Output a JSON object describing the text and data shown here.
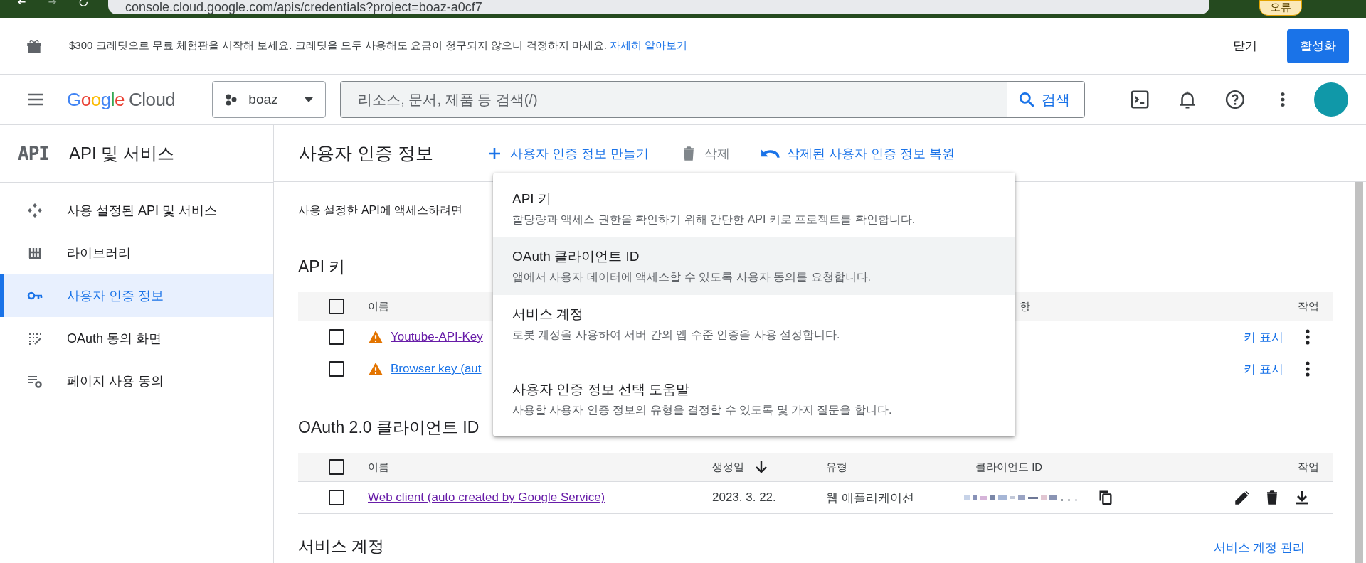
{
  "browser": {
    "url": "console.cloud.google.com/apis/credentials?project=boaz-a0cf7",
    "badge": "오류"
  },
  "promo_banner": {
    "text": "$300 크레딧으로 무료 체험판을 시작해 보세요. 크레딧을 모두 사용해도 요금이 청구되지 않으니 걱정하지 마세요.",
    "link": "자세히 알아보기",
    "dismiss": "닫기",
    "activate": "활성화"
  },
  "header": {
    "logo": "Google",
    "product": "Cloud",
    "project": "boaz",
    "search_placeholder": "리소스, 문서, 제품 등 검색(/)",
    "search_button": "검색"
  },
  "sidebar": {
    "badge": "API",
    "title": "API 및 서비스",
    "items": [
      {
        "label": "사용 설정된 API 및 서비스",
        "kind": "diamond",
        "selected": false
      },
      {
        "label": "라이브러리",
        "kind": "library",
        "selected": false
      },
      {
        "label": "사용자 인증 정보",
        "kind": "key",
        "selected": true
      },
      {
        "label": "OAuth 동의 화면",
        "kind": "consent",
        "selected": false
      },
      {
        "label": "페이지 사용 동의",
        "kind": "settings",
        "selected": false
      }
    ]
  },
  "main": {
    "title": "사용자 인증 정보",
    "actions": [
      {
        "label": "사용자 인증 정보 만들기",
        "kind": "add",
        "disabled": false
      },
      {
        "label": "삭제",
        "kind": "delete",
        "disabled": true
      },
      {
        "label": "삭제된 사용자 인증 정보 복원",
        "kind": "restore",
        "disabled": false
      }
    ],
    "intro": "사용 설정한 API에 액세스하려면",
    "api_keys": {
      "heading": "API 키",
      "all_checked": false,
      "columns": [
        "이름",
        "항",
        "작업"
      ],
      "rows": [
        {
          "name": "Youtube-API-Key",
          "visited": true,
          "warning": true,
          "checked": false,
          "action": "키 표시"
        },
        {
          "name": "Browser key (aut",
          "visited": false,
          "warning": true,
          "checked": false,
          "action": "키 표시"
        }
      ]
    },
    "oauth_clients": {
      "heading": "OAuth 2.0 클라이언트 ID",
      "all_checked": false,
      "columns": [
        "이름",
        "생성일",
        "유형",
        "클라이언트 ID",
        "작업"
      ],
      "rows": [
        {
          "name": "Web client (auto created by Google Service)",
          "visited": true,
          "checked": false,
          "created": "2023. 3. 22.",
          "type": "웹 애플리케이션"
        }
      ]
    },
    "service_accounts": {
      "heading": "서비스 계정",
      "link": "서비스 계정 관리"
    }
  },
  "create_menu": {
    "items": [
      {
        "title": "API 키",
        "description": "할당량과 액세스 권한을 확인하기 위해 간단한 API 키로 프로젝트를 확인합니다.",
        "highlighted": false,
        "divider_before": false
      },
      {
        "title": "OAuth 클라이언트 ID",
        "description": "앱에서 사용자 데이터에 액세스할 수 있도록 사용자 동의를 요청합니다.",
        "highlighted": true,
        "divider_before": false
      },
      {
        "title": "서비스 계정",
        "description": "로봇 계정을 사용하여 서버 간의 앱 수준 인증을 사용 설정합니다.",
        "highlighted": false,
        "divider_before": false
      },
      {
        "title": "사용자 인증 정보 선택 도움말",
        "description": "사용할 사용자 인증 정보의 유형을 결정할 수 있도록 몇 가지 질문을 합니다.",
        "highlighted": false,
        "divider_before": true
      }
    ]
  }
}
